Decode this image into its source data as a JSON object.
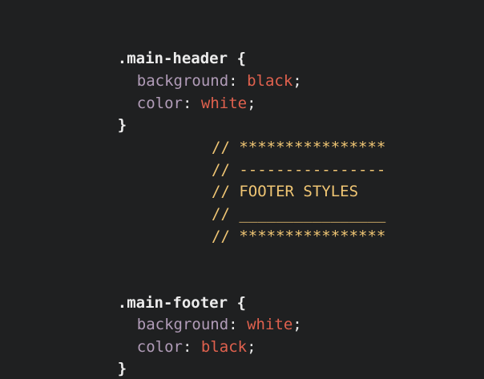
{
  "code": {
    "header_rule": {
      "selector": ".main-header",
      "open_brace": "{",
      "close_brace": "}",
      "declarations": [
        {
          "property": "background",
          "value": "black"
        },
        {
          "property": "color",
          "value": "white"
        }
      ]
    },
    "comment_block": [
      "// ****************",
      "// ----------------",
      "// FOOTER STYLES",
      "// ________________",
      "// ****************"
    ],
    "footer_rule": {
      "selector": ".main-footer",
      "open_brace": "{",
      "close_brace": "}",
      "declarations": [
        {
          "property": "background",
          "value": "white"
        },
        {
          "property": "color",
          "value": "black"
        }
      ]
    },
    "punctuation": {
      "colon": ":",
      "semicolon": ";"
    }
  },
  "colors": {
    "background": "#1f2021",
    "selector": "#ececec",
    "property": "#b19cb8",
    "value": "#e0614e",
    "comment": "#f0c674"
  }
}
